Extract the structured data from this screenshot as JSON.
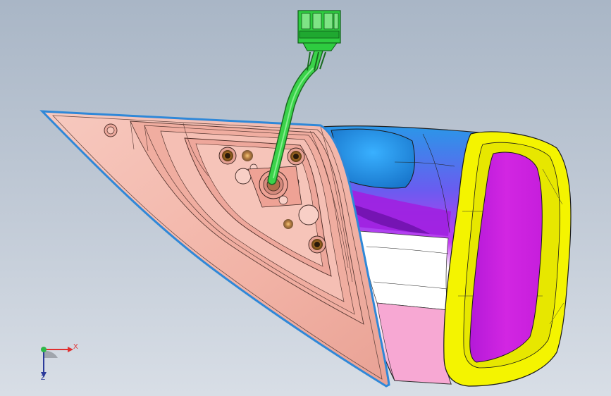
{
  "viewport": {
    "background_top": "#a9b6c6",
    "background_bottom": "#d8dee6"
  },
  "model": {
    "shell_color": "#f2b6aa",
    "shell_outline_color": "#2f88d8",
    "housing_colors": [
      "#1f8fe0",
      "#b53cf2",
      "#ffffff",
      "#f59acb"
    ],
    "bezel_color": "#f4f400",
    "glass_color": "#cc22dd",
    "cable_color": "#3ad34a",
    "connector_color": "#2ecc40"
  },
  "triad": {
    "x_label": "X",
    "z_label": "Z",
    "x_color": "#e03030",
    "y_color": "#2fb84a",
    "z_color": "#2a3a9a"
  }
}
